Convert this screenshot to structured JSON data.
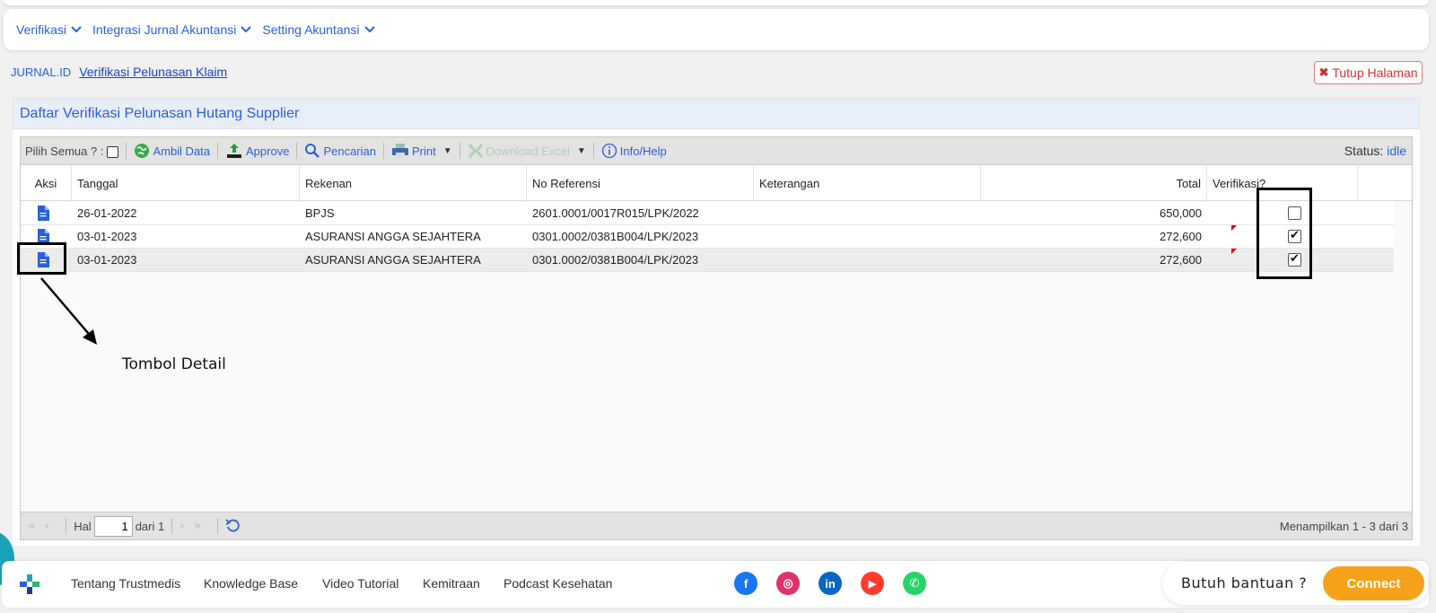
{
  "menu": {
    "items": [
      {
        "label": "Verifikasi"
      },
      {
        "label": "Integrasi Jurnal Akuntansi"
      },
      {
        "label": "Setting Akuntansi"
      }
    ]
  },
  "breadcrumb": {
    "root": "JURNAL.ID",
    "current": "Verifikasi Pelunasan Klaim"
  },
  "close_page_label": "Tutup Halaman",
  "panel_title": "Daftar Verifikasi Pelunasan Hutang Supplier",
  "toolbar": {
    "select_all_label": "Pilih Semua ? :",
    "ambil_data": "Ambil Data",
    "approve": "Approve",
    "pencarian": "Pencarian",
    "print": "Print",
    "download_excel": "Download Excel",
    "info_help": "Info/Help",
    "status_label": "Status:",
    "status_value": "idle"
  },
  "table": {
    "columns": [
      "Aksi",
      "Tanggal",
      "Rekenan",
      "No Referensi",
      "Keterangan",
      "Total",
      "Verifikasi?"
    ],
    "rows": [
      {
        "tanggal": "26-01-2022",
        "rekenan": "BPJS",
        "no_referensi": "2601.0001/0017R015/LPK/2022",
        "keterangan": "",
        "total": "650,000",
        "verifikasi": false
      },
      {
        "tanggal": "03-01-2023",
        "rekenan": "ASURANSI ANGGA SEJAHTERA",
        "no_referensi": "0301.0002/0381B004/LPK/2023",
        "keterangan": "",
        "total": "272,600",
        "verifikasi": true
      },
      {
        "tanggal": "03-01-2023",
        "rekenan": "ASURANSI ANGGA SEJAHTERA",
        "no_referensi": "0301.0002/0381B004/LPK/2023",
        "keterangan": "",
        "total": "272,600",
        "verifikasi": true
      }
    ]
  },
  "pager": {
    "hal_label": "Hal",
    "page": "1",
    "of_label": "dari 1",
    "info": "Menampilkan 1 - 3 dari 3"
  },
  "annotation": {
    "label": "Tombol Detail"
  },
  "footer": {
    "links": [
      "Tentang Trustmedis",
      "Knowledge Base",
      "Video Tutorial",
      "Kemitraan",
      "Podcast Kesehatan"
    ],
    "social": [
      {
        "name": "facebook-icon",
        "color": "#1877f2",
        "glyph": "f"
      },
      {
        "name": "instagram-icon",
        "color": "#e1306c",
        "glyph": "◎"
      },
      {
        "name": "linkedin-icon",
        "color": "#0a66c2",
        "glyph": "in"
      },
      {
        "name": "youtube-icon",
        "color": "#ff3b30",
        "glyph": "▶"
      },
      {
        "name": "whatsapp-icon",
        "color": "#25d366",
        "glyph": "✆"
      }
    ],
    "help_text": "Butuh bantuan ?",
    "connect_label": "Connect"
  },
  "colors": {
    "accent": "#2a5fd6",
    "connect": "#f7a21b",
    "danger": "#d23131"
  }
}
